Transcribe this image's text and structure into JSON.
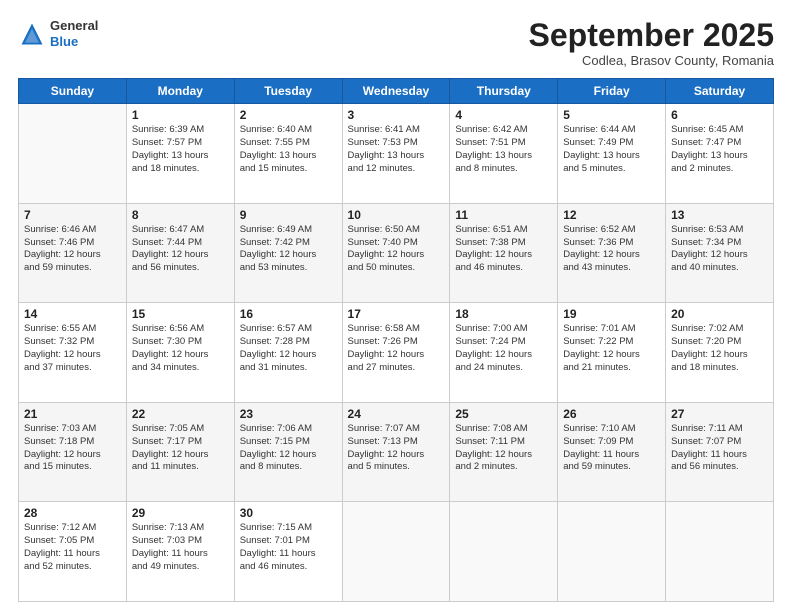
{
  "header": {
    "logo_general": "General",
    "logo_blue": "Blue",
    "month_title": "September 2025",
    "subtitle": "Codlea, Brasov County, Romania"
  },
  "weekdays": [
    "Sunday",
    "Monday",
    "Tuesday",
    "Wednesday",
    "Thursday",
    "Friday",
    "Saturday"
  ],
  "rows": [
    [
      {
        "day": "",
        "lines": []
      },
      {
        "day": "1",
        "lines": [
          "Sunrise: 6:39 AM",
          "Sunset: 7:57 PM",
          "Daylight: 13 hours",
          "and 18 minutes."
        ]
      },
      {
        "day": "2",
        "lines": [
          "Sunrise: 6:40 AM",
          "Sunset: 7:55 PM",
          "Daylight: 13 hours",
          "and 15 minutes."
        ]
      },
      {
        "day": "3",
        "lines": [
          "Sunrise: 6:41 AM",
          "Sunset: 7:53 PM",
          "Daylight: 13 hours",
          "and 12 minutes."
        ]
      },
      {
        "day": "4",
        "lines": [
          "Sunrise: 6:42 AM",
          "Sunset: 7:51 PM",
          "Daylight: 13 hours",
          "and 8 minutes."
        ]
      },
      {
        "day": "5",
        "lines": [
          "Sunrise: 6:44 AM",
          "Sunset: 7:49 PM",
          "Daylight: 13 hours",
          "and 5 minutes."
        ]
      },
      {
        "day": "6",
        "lines": [
          "Sunrise: 6:45 AM",
          "Sunset: 7:47 PM",
          "Daylight: 13 hours",
          "and 2 minutes."
        ]
      }
    ],
    [
      {
        "day": "7",
        "lines": [
          "Sunrise: 6:46 AM",
          "Sunset: 7:46 PM",
          "Daylight: 12 hours",
          "and 59 minutes."
        ]
      },
      {
        "day": "8",
        "lines": [
          "Sunrise: 6:47 AM",
          "Sunset: 7:44 PM",
          "Daylight: 12 hours",
          "and 56 minutes."
        ]
      },
      {
        "day": "9",
        "lines": [
          "Sunrise: 6:49 AM",
          "Sunset: 7:42 PM",
          "Daylight: 12 hours",
          "and 53 minutes."
        ]
      },
      {
        "day": "10",
        "lines": [
          "Sunrise: 6:50 AM",
          "Sunset: 7:40 PM",
          "Daylight: 12 hours",
          "and 50 minutes."
        ]
      },
      {
        "day": "11",
        "lines": [
          "Sunrise: 6:51 AM",
          "Sunset: 7:38 PM",
          "Daylight: 12 hours",
          "and 46 minutes."
        ]
      },
      {
        "day": "12",
        "lines": [
          "Sunrise: 6:52 AM",
          "Sunset: 7:36 PM",
          "Daylight: 12 hours",
          "and 43 minutes."
        ]
      },
      {
        "day": "13",
        "lines": [
          "Sunrise: 6:53 AM",
          "Sunset: 7:34 PM",
          "Daylight: 12 hours",
          "and 40 minutes."
        ]
      }
    ],
    [
      {
        "day": "14",
        "lines": [
          "Sunrise: 6:55 AM",
          "Sunset: 7:32 PM",
          "Daylight: 12 hours",
          "and 37 minutes."
        ]
      },
      {
        "day": "15",
        "lines": [
          "Sunrise: 6:56 AM",
          "Sunset: 7:30 PM",
          "Daylight: 12 hours",
          "and 34 minutes."
        ]
      },
      {
        "day": "16",
        "lines": [
          "Sunrise: 6:57 AM",
          "Sunset: 7:28 PM",
          "Daylight: 12 hours",
          "and 31 minutes."
        ]
      },
      {
        "day": "17",
        "lines": [
          "Sunrise: 6:58 AM",
          "Sunset: 7:26 PM",
          "Daylight: 12 hours",
          "and 27 minutes."
        ]
      },
      {
        "day": "18",
        "lines": [
          "Sunrise: 7:00 AM",
          "Sunset: 7:24 PM",
          "Daylight: 12 hours",
          "and 24 minutes."
        ]
      },
      {
        "day": "19",
        "lines": [
          "Sunrise: 7:01 AM",
          "Sunset: 7:22 PM",
          "Daylight: 12 hours",
          "and 21 minutes."
        ]
      },
      {
        "day": "20",
        "lines": [
          "Sunrise: 7:02 AM",
          "Sunset: 7:20 PM",
          "Daylight: 12 hours",
          "and 18 minutes."
        ]
      }
    ],
    [
      {
        "day": "21",
        "lines": [
          "Sunrise: 7:03 AM",
          "Sunset: 7:18 PM",
          "Daylight: 12 hours",
          "and 15 minutes."
        ]
      },
      {
        "day": "22",
        "lines": [
          "Sunrise: 7:05 AM",
          "Sunset: 7:17 PM",
          "Daylight: 12 hours",
          "and 11 minutes."
        ]
      },
      {
        "day": "23",
        "lines": [
          "Sunrise: 7:06 AM",
          "Sunset: 7:15 PM",
          "Daylight: 12 hours",
          "and 8 minutes."
        ]
      },
      {
        "day": "24",
        "lines": [
          "Sunrise: 7:07 AM",
          "Sunset: 7:13 PM",
          "Daylight: 12 hours",
          "and 5 minutes."
        ]
      },
      {
        "day": "25",
        "lines": [
          "Sunrise: 7:08 AM",
          "Sunset: 7:11 PM",
          "Daylight: 12 hours",
          "and 2 minutes."
        ]
      },
      {
        "day": "26",
        "lines": [
          "Sunrise: 7:10 AM",
          "Sunset: 7:09 PM",
          "Daylight: 11 hours",
          "and 59 minutes."
        ]
      },
      {
        "day": "27",
        "lines": [
          "Sunrise: 7:11 AM",
          "Sunset: 7:07 PM",
          "Daylight: 11 hours",
          "and 56 minutes."
        ]
      }
    ],
    [
      {
        "day": "28",
        "lines": [
          "Sunrise: 7:12 AM",
          "Sunset: 7:05 PM",
          "Daylight: 11 hours",
          "and 52 minutes."
        ]
      },
      {
        "day": "29",
        "lines": [
          "Sunrise: 7:13 AM",
          "Sunset: 7:03 PM",
          "Daylight: 11 hours",
          "and 49 minutes."
        ]
      },
      {
        "day": "30",
        "lines": [
          "Sunrise: 7:15 AM",
          "Sunset: 7:01 PM",
          "Daylight: 11 hours",
          "and 46 minutes."
        ]
      },
      {
        "day": "",
        "lines": []
      },
      {
        "day": "",
        "lines": []
      },
      {
        "day": "",
        "lines": []
      },
      {
        "day": "",
        "lines": []
      }
    ]
  ]
}
